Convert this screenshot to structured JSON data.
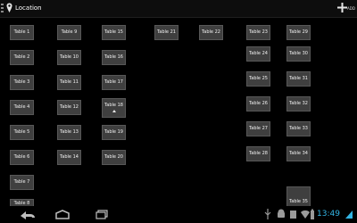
{
  "action_bar": {
    "title": "Location",
    "add_label": "ADD"
  },
  "tables": [
    "Table 1",
    "Table 2",
    "Table 3",
    "Table 4",
    "Table 5",
    "Table 6",
    "Table 7",
    "Table 8",
    "Table 9",
    "Table 10",
    "Table 11",
    "Table 12",
    "Table 13",
    "Table 14",
    "Table 15",
    "Table 16",
    "Table 17",
    "Table 18",
    "Table 19",
    "Table 20",
    "Table 21",
    "Table 22",
    "Table 23",
    "Table 24",
    "Table 25",
    "Table 26",
    "Table 27",
    "Table 28",
    "Table 29",
    "Table 30",
    "Table 31",
    "Table 32",
    "Table 33",
    "Table 34",
    "Table 35"
  ],
  "status_bar": {
    "time": "13:49"
  }
}
